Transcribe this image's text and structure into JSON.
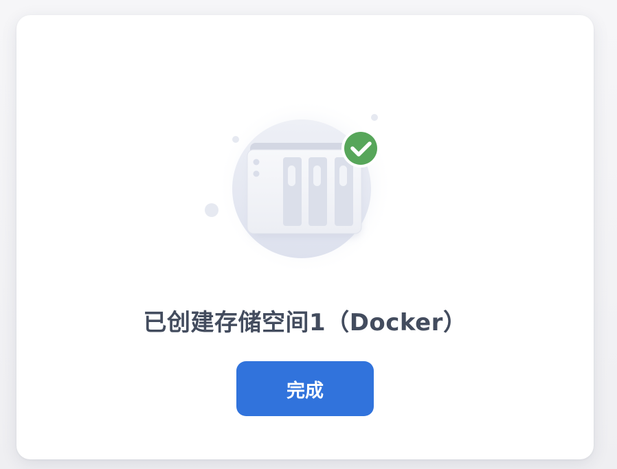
{
  "dialog": {
    "title": "已创建存储空间1（Docker）",
    "done_label": "完成"
  },
  "illustration": {
    "device": "nas-device-icon",
    "badge": "check-circle-icon",
    "badge_color": "#57a65a"
  },
  "colors": {
    "primary_button": "#3173dc",
    "title_text": "#434c5e"
  }
}
